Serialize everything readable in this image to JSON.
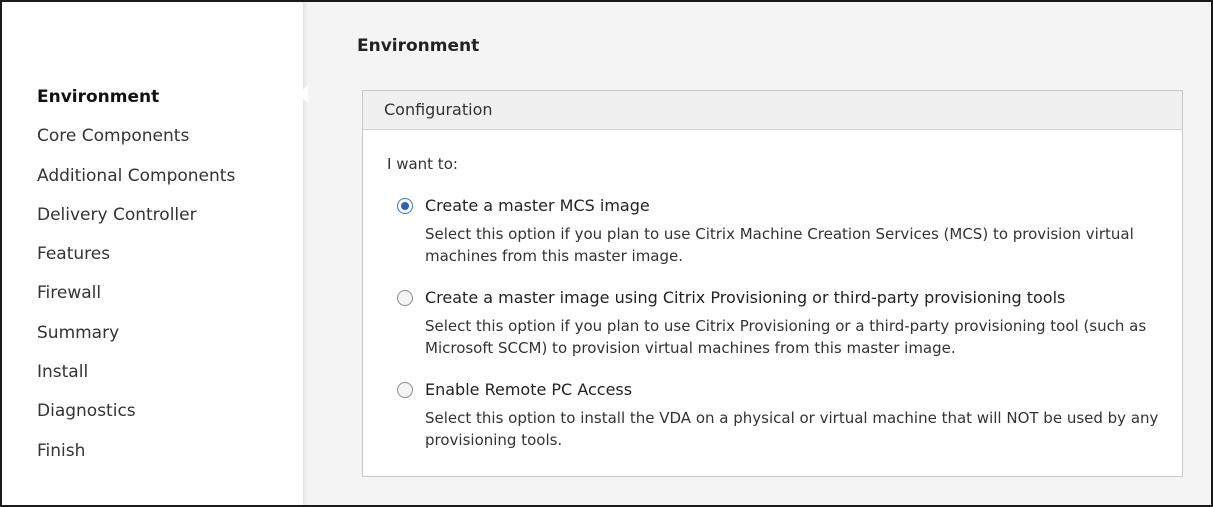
{
  "sidebar": {
    "items": [
      {
        "label": "Environment",
        "active": true
      },
      {
        "label": "Core Components"
      },
      {
        "label": "Additional Components"
      },
      {
        "label": "Delivery Controller"
      },
      {
        "label": "Features"
      },
      {
        "label": "Firewall"
      },
      {
        "label": "Summary"
      },
      {
        "label": "Install"
      },
      {
        "label": "Diagnostics"
      },
      {
        "label": "Finish"
      }
    ]
  },
  "main": {
    "title": "Environment",
    "panel": {
      "header": "Configuration",
      "prompt": "I want to:",
      "options": [
        {
          "label": "Create a master MCS image",
          "description": "Select this option if you plan to use Citrix Machine Creation Services (MCS) to provision virtual machines from this master image.",
          "selected": true
        },
        {
          "label": "Create a master image using Citrix Provisioning or third-party provisioning tools",
          "description": "Select this option if you plan to use Citrix Provisioning or a third-party provisioning tool (such as Microsoft SCCM) to provision virtual machines from this master image.",
          "selected": false
        },
        {
          "label": "Enable Remote PC Access",
          "description": "Select this option to install the VDA on a physical or virtual machine that will NOT be used by any provisioning tools.",
          "selected": false
        }
      ]
    }
  }
}
